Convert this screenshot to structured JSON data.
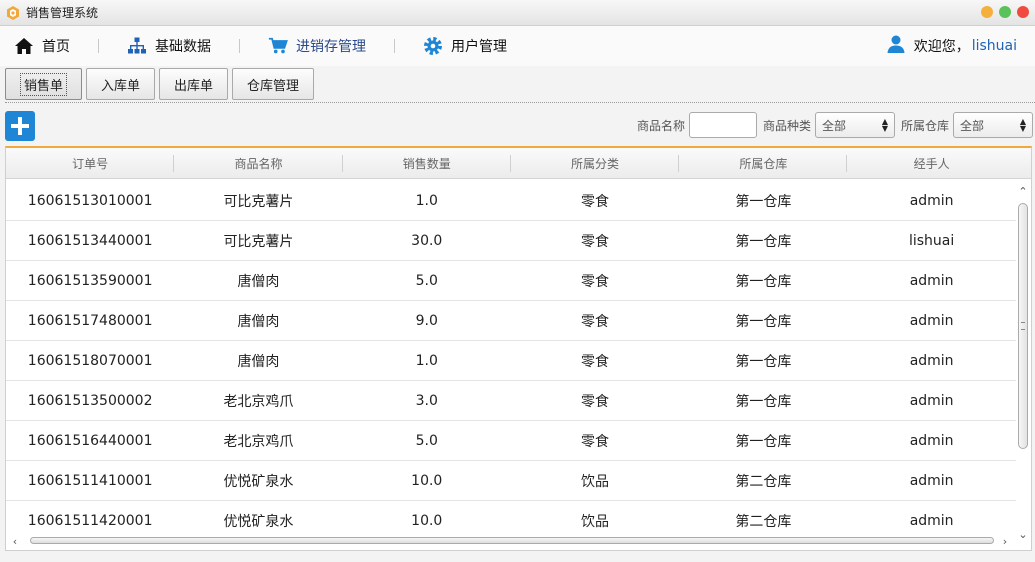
{
  "window": {
    "title": "销售管理系统",
    "controls": [
      "#f4b03a",
      "#5ac25a",
      "#ef4c3f"
    ]
  },
  "nav": {
    "items": [
      {
        "label": "首页",
        "icon": "home-icon"
      },
      {
        "label": "基础数据",
        "icon": "sitemap-icon"
      },
      {
        "label": "进销存管理",
        "icon": "cart-icon",
        "active": true
      },
      {
        "label": "用户管理",
        "icon": "gear-icon"
      }
    ],
    "greeting": "欢迎您，",
    "username": "lishuai",
    "accent": "#1f63b5"
  },
  "tabs": [
    {
      "label": "销售单",
      "active": true
    },
    {
      "label": "入库单"
    },
    {
      "label": "出库单"
    },
    {
      "label": "仓库管理"
    }
  ],
  "toolbar": {
    "add_icon": "plus-icon",
    "filters": {
      "product_name_label": "商品名称",
      "product_name_value": "",
      "category_label": "商品种类",
      "category_value": "全部",
      "warehouse_label": "所属仓库",
      "warehouse_value": "全部"
    }
  },
  "table": {
    "columns": [
      "订单号",
      "商品名称",
      "销售数量",
      "所属分类",
      "所属仓库",
      "经手人"
    ],
    "rows": [
      [
        "16061513010001",
        "可比克薯片",
        "1.0",
        "零食",
        "第一仓库",
        "admin"
      ],
      [
        "16061513440001",
        "可比克薯片",
        "30.0",
        "零食",
        "第一仓库",
        "lishuai"
      ],
      [
        "16061513590001",
        "唐僧肉",
        "5.0",
        "零食",
        "第一仓库",
        "admin"
      ],
      [
        "16061517480001",
        "唐僧肉",
        "9.0",
        "零食",
        "第一仓库",
        "admin"
      ],
      [
        "16061518070001",
        "唐僧肉",
        "1.0",
        "零食",
        "第一仓库",
        "admin"
      ],
      [
        "16061513500002",
        "老北京鸡爪",
        "3.0",
        "零食",
        "第一仓库",
        "admin"
      ],
      [
        "16061516440001",
        "老北京鸡爪",
        "5.0",
        "零食",
        "第一仓库",
        "admin"
      ],
      [
        "16061511410001",
        "优悦矿泉水",
        "10.0",
        "饮品",
        "第二仓库",
        "admin"
      ],
      [
        "16061511420001",
        "优悦矿泉水",
        "10.0",
        "饮品",
        "第二仓库",
        "admin"
      ]
    ],
    "header_accent": "#f2a93b"
  }
}
